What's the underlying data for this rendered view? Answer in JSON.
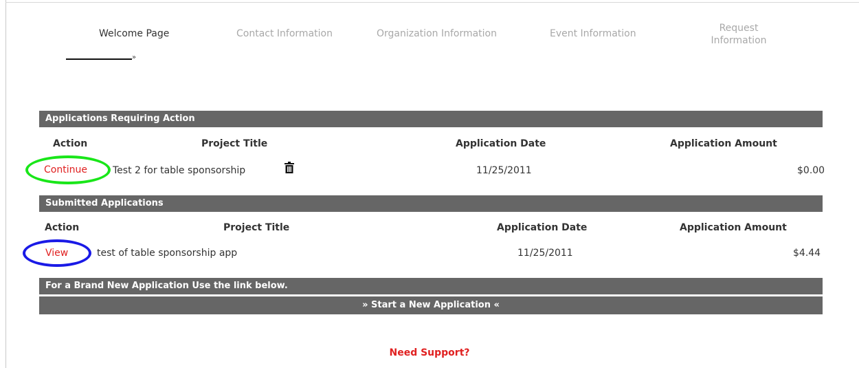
{
  "wizard": {
    "steps": [
      {
        "label": "Welcome Page",
        "active": true
      },
      {
        "label": "Contact Information",
        "active": false
      },
      {
        "label": "Organization Information",
        "active": false
      },
      {
        "label": "Event Information",
        "active": false
      },
      {
        "label": "Request Information",
        "active": false
      }
    ],
    "arrow_glyph": "»"
  },
  "requiring_action": {
    "header": "Applications Requiring Action",
    "columns": [
      "Action",
      "Project Title",
      "Application Date",
      "Application Amount"
    ],
    "rows": [
      {
        "action": "Continue",
        "title": "Test 2 for table sponsorship",
        "date": "11/25/2011",
        "amount": "$0.00",
        "icon": "trash-icon"
      }
    ]
  },
  "submitted": {
    "header": "Submitted Applications",
    "columns": [
      "Action",
      "Project Title",
      "Application Date",
      "Application Amount"
    ],
    "rows": [
      {
        "action": "View",
        "title": "test of table sponsorship app",
        "date": "11/25/2011",
        "amount": "$4.44"
      }
    ]
  },
  "new_application": {
    "header": "For a Brand New Application Use the link below.",
    "link": "» Start a New Application «"
  },
  "support": {
    "label": "Need Support?"
  },
  "colors": {
    "bar": "#666666",
    "link": "#e02020",
    "highlight_continue": "#19e619",
    "highlight_view": "#1a1ae6"
  }
}
